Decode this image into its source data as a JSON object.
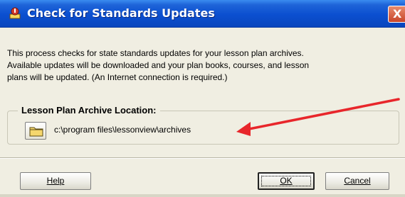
{
  "window": {
    "title": "Check for Standards Updates",
    "close_label": "X"
  },
  "description": {
    "lines": [
      "This process checks for state standards updates for your lesson plan archives.",
      "Available updates will be downloaded and your plan books, courses, and lesson",
      "plans will be updated.  (An Internet connection is required.)"
    ]
  },
  "archive": {
    "group_label": "Lesson Plan Archive Location:",
    "path": "c:\\program files\\lessonview\\archives"
  },
  "buttons": {
    "help": "Help",
    "ok": "OK",
    "cancel": "Cancel"
  },
  "colors": {
    "titlebar": "#0b4fd0",
    "arrow": "#e8262b",
    "dialog_bg": "#f0eee2"
  }
}
